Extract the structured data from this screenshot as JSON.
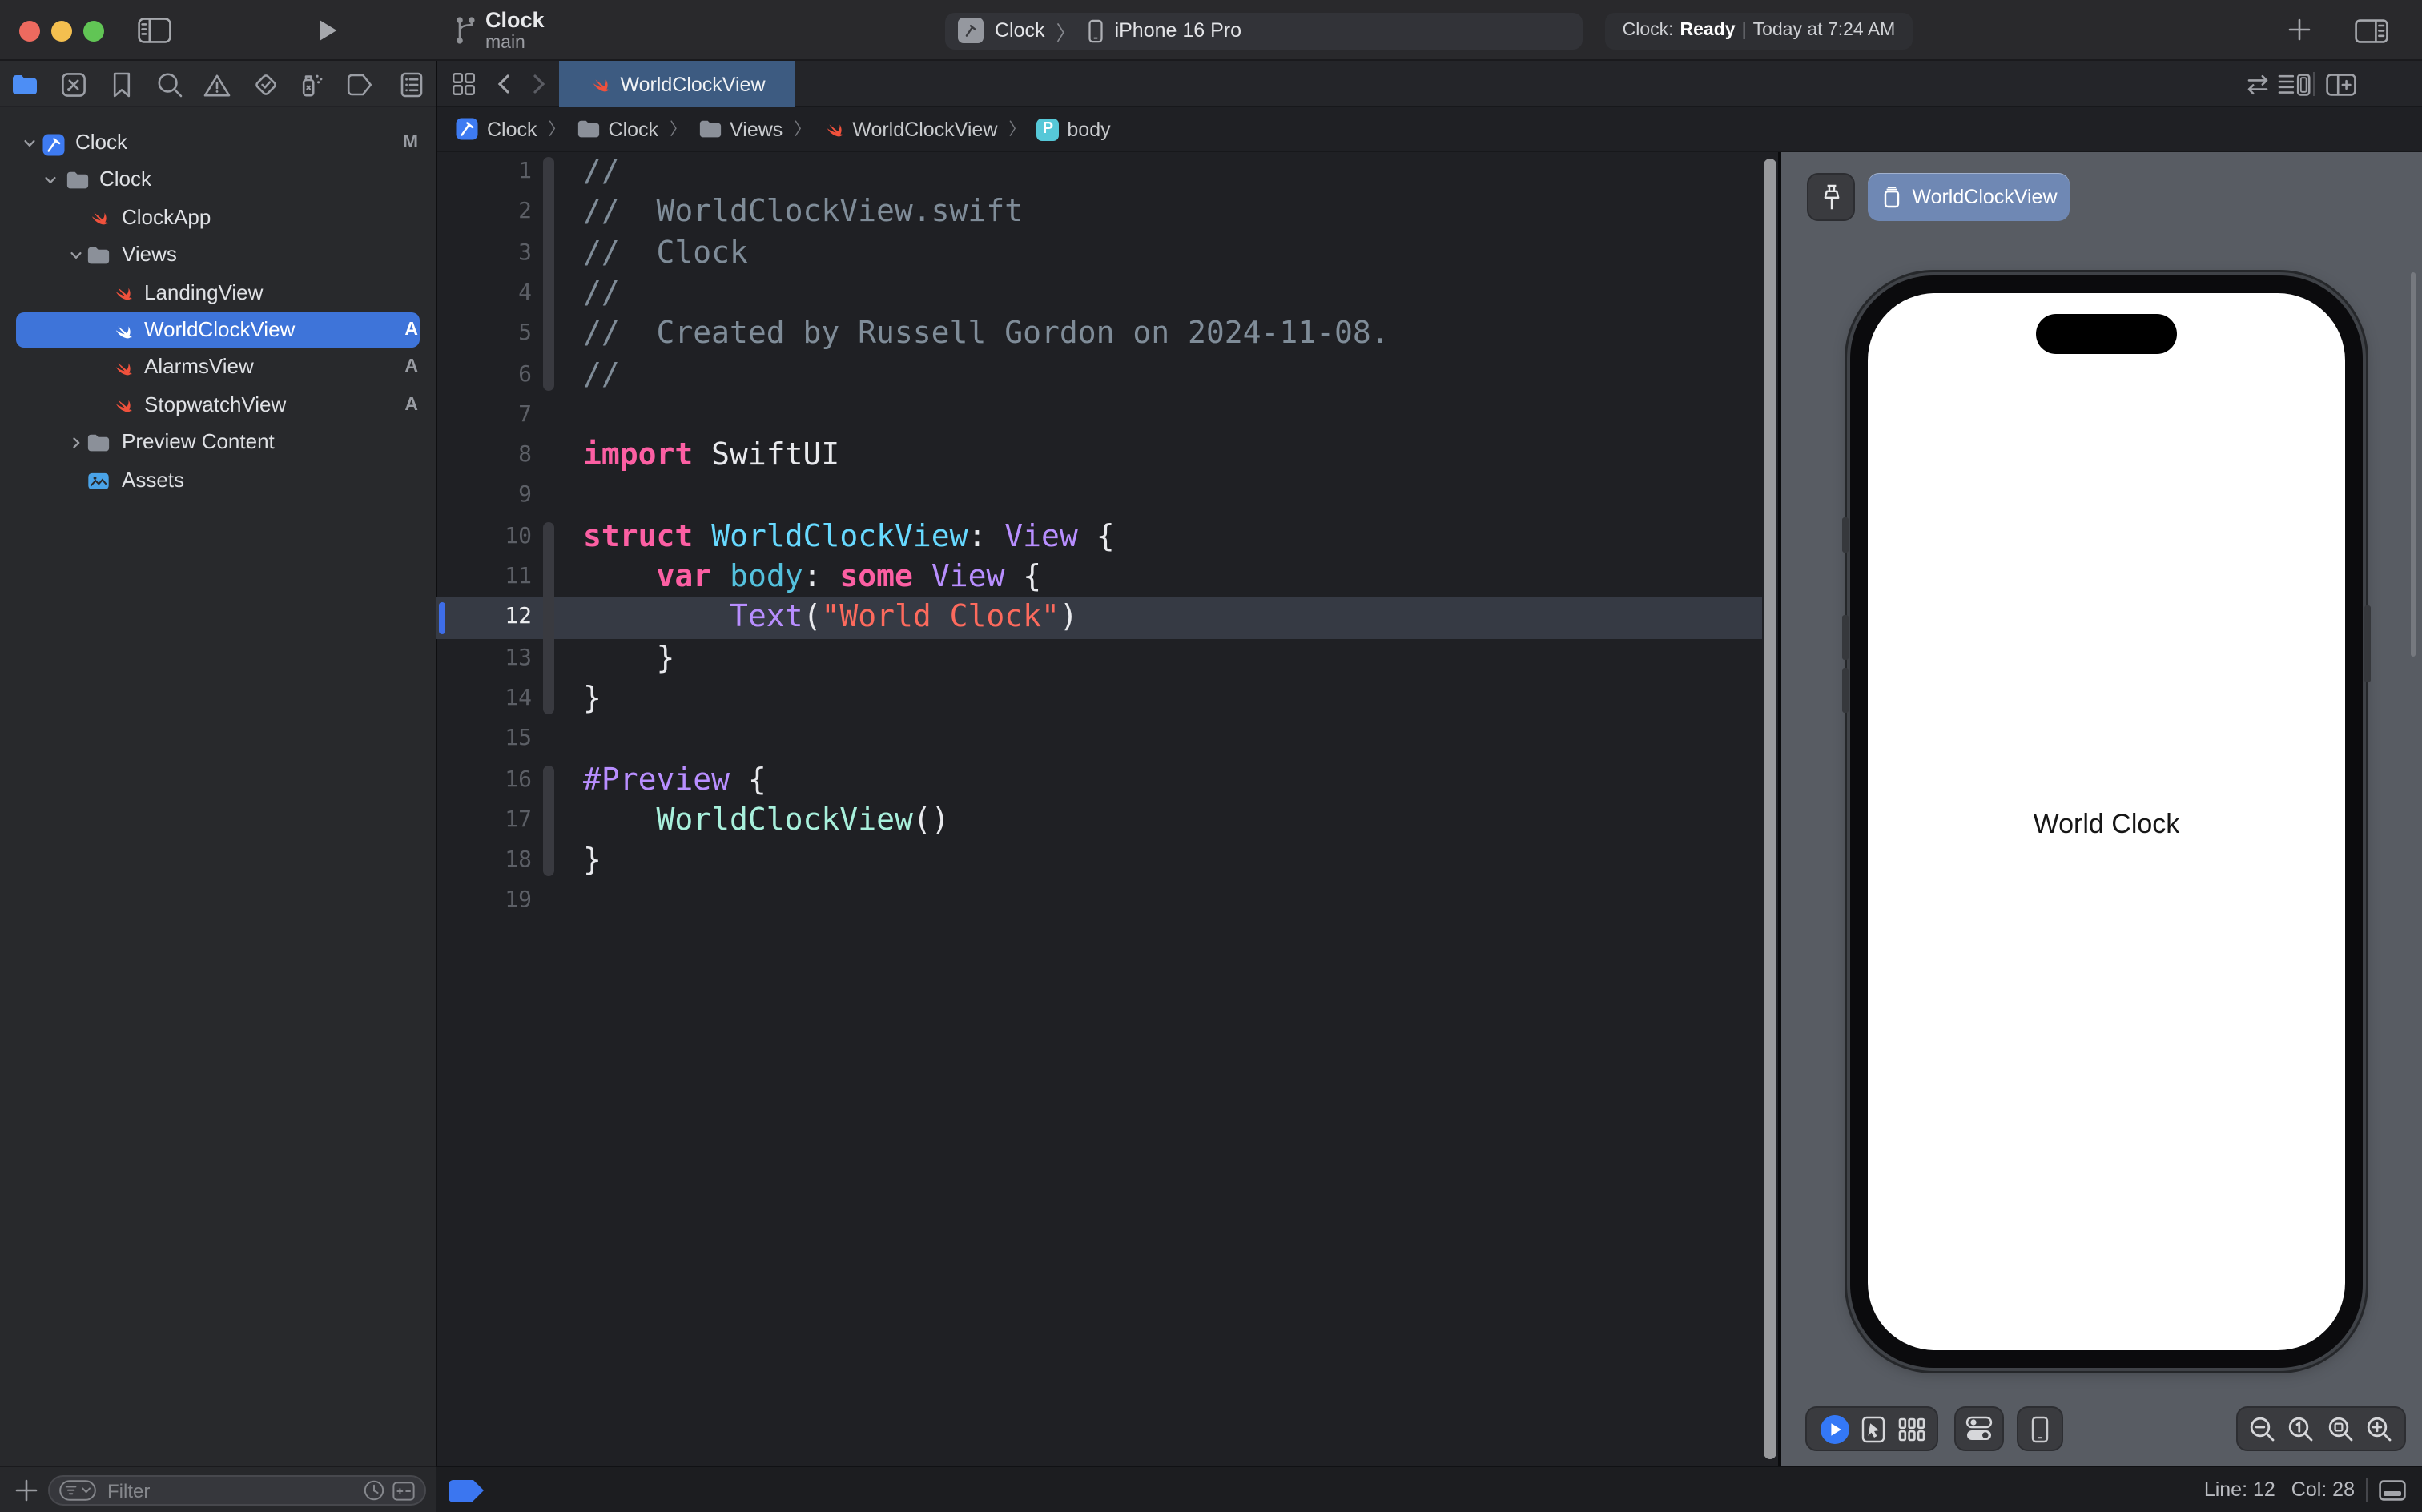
{
  "titlebar": {
    "project": "Clock",
    "branch": "main",
    "scheme": {
      "target": "Clock",
      "separator": "〉",
      "device": "iPhone 16 Pro"
    },
    "status": {
      "app": "Clock:",
      "state": "Ready",
      "separator": "|",
      "time": "Today at 7:24 AM"
    }
  },
  "navigator": {
    "toolbar": [
      "project-navigator",
      "source-control-navigator",
      "bookmarks-navigator",
      "find-navigator",
      "issues-navigator",
      "tests-navigator",
      "debug-navigator",
      "breakpoints-navigator",
      "reports-navigator"
    ],
    "tree": [
      {
        "label": "Clock",
        "icon": "xcode-project",
        "chevron": "down",
        "level": 1,
        "badge": "M"
      },
      {
        "label": "Clock",
        "icon": "folder",
        "chevron": "down",
        "level": 2
      },
      {
        "label": "ClockApp",
        "icon": "swift",
        "level": 3
      },
      {
        "label": "Views",
        "icon": "folder",
        "chevron": "down",
        "level": 3
      },
      {
        "label": "LandingView",
        "icon": "swift",
        "level": 4
      },
      {
        "label": "WorldClockView",
        "icon": "swift",
        "level": 4,
        "badge": "A",
        "selected": true
      },
      {
        "label": "AlarmsView",
        "icon": "swift",
        "level": 4,
        "badge": "A"
      },
      {
        "label": "StopwatchView",
        "icon": "swift",
        "level": 4,
        "badge": "A"
      },
      {
        "label": "Preview Content",
        "icon": "folder",
        "chevron": "right",
        "level": 3
      },
      {
        "label": "Assets",
        "icon": "assets",
        "level": 3
      }
    ],
    "filter": {
      "placeholder": "Filter"
    }
  },
  "tabs": {
    "active": "WorldClockView"
  },
  "jumpbar": {
    "separator": "〉",
    "segments": [
      {
        "icon": "xcode-project",
        "label": "Clock"
      },
      {
        "icon": "folder",
        "label": "Clock"
      },
      {
        "icon": "folder",
        "label": "Views"
      },
      {
        "icon": "swift",
        "label": "WorldClockView"
      },
      {
        "icon": "p-chip",
        "label": "body"
      }
    ]
  },
  "editor": {
    "current_line": 12,
    "fold_ribbons": [
      [
        1,
        6
      ],
      [
        10,
        14
      ],
      [
        16,
        18
      ]
    ],
    "lines": [
      {
        "n": 1,
        "tokens": [
          {
            "c": "com",
            "t": "//"
          }
        ]
      },
      {
        "n": 2,
        "tokens": [
          {
            "c": "com",
            "t": "//  WorldClockView.swift"
          }
        ]
      },
      {
        "n": 3,
        "tokens": [
          {
            "c": "com",
            "t": "//  Clock"
          }
        ]
      },
      {
        "n": 4,
        "tokens": [
          {
            "c": "com",
            "t": "//"
          }
        ]
      },
      {
        "n": 5,
        "tokens": [
          {
            "c": "com",
            "t": "//  Created by Russell Gordon on 2024-11-08."
          }
        ]
      },
      {
        "n": 6,
        "tokens": [
          {
            "c": "com",
            "t": "//"
          }
        ]
      },
      {
        "n": 7,
        "tokens": []
      },
      {
        "n": 8,
        "tokens": [
          {
            "c": "kw",
            "t": "import"
          },
          {
            "c": "plain",
            "t": " SwiftUI"
          }
        ]
      },
      {
        "n": 9,
        "tokens": []
      },
      {
        "n": 10,
        "tokens": [
          {
            "c": "kw",
            "t": "struct"
          },
          {
            "c": "plain",
            "t": " "
          },
          {
            "c": "decl",
            "t": "WorldClockView"
          },
          {
            "c": "plain",
            "t": ": "
          },
          {
            "c": "type",
            "t": "View"
          },
          {
            "c": "plain",
            "t": " {"
          }
        ]
      },
      {
        "n": 11,
        "tokens": [
          {
            "c": "plain",
            "t": "    "
          },
          {
            "c": "kw",
            "t": "var"
          },
          {
            "c": "plain",
            "t": " "
          },
          {
            "c": "prop",
            "t": "body"
          },
          {
            "c": "plain",
            "t": ": "
          },
          {
            "c": "kw",
            "t": "some"
          },
          {
            "c": "plain",
            "t": " "
          },
          {
            "c": "type",
            "t": "View"
          },
          {
            "c": "plain",
            "t": " {"
          }
        ]
      },
      {
        "n": 12,
        "tokens": [
          {
            "c": "plain",
            "t": "        "
          },
          {
            "c": "type",
            "t": "Text"
          },
          {
            "c": "plain",
            "t": "("
          },
          {
            "c": "str",
            "t": "\"World Clock\""
          },
          {
            "c": "plain",
            "t": ")"
          }
        ]
      },
      {
        "n": 13,
        "tokens": [
          {
            "c": "plain",
            "t": "    }"
          }
        ]
      },
      {
        "n": 14,
        "tokens": [
          {
            "c": "plain",
            "t": "}"
          }
        ]
      },
      {
        "n": 15,
        "tokens": []
      },
      {
        "n": 16,
        "tokens": [
          {
            "c": "type",
            "t": "#Preview"
          },
          {
            "c": "plain",
            "t": " {"
          }
        ]
      },
      {
        "n": 17,
        "tokens": [
          {
            "c": "plain",
            "t": "    "
          },
          {
            "c": "mint",
            "t": "WorldClockView"
          },
          {
            "c": "plain",
            "t": "()"
          }
        ]
      },
      {
        "n": 18,
        "tokens": [
          {
            "c": "plain",
            "t": "}"
          }
        ]
      },
      {
        "n": 19,
        "tokens": []
      }
    ]
  },
  "preview": {
    "pill": {
      "icon": "device-chip",
      "label": "WorldClockView"
    },
    "screen_text": "World Clock",
    "toolbar_left": [
      "live-preview-play",
      "pointer-device",
      "grid-variants"
    ],
    "toolbar_device_settings": [
      "device-settings-toggles"
    ],
    "toolbar_device": [
      "device-phone"
    ],
    "toolbar_zoom": [
      "zoom-out",
      "zoom-actual",
      "zoom-fit",
      "zoom-in"
    ]
  },
  "statusbar": {
    "line": "Line: 12",
    "col": "Col: 28"
  },
  "colors": {
    "accent_selection": "#3e74d9",
    "tab_active": "#3d5b81",
    "canvas": "#585c63",
    "play_blue": "#3478f6",
    "swift_orange": "#f0513c",
    "traffic_red": "#ed6a5f",
    "traffic_yellow": "#f4bf4f",
    "traffic_green": "#61c555"
  }
}
